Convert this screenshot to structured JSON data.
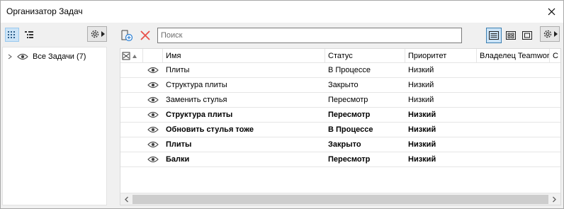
{
  "window": {
    "title": "Организатор Задач"
  },
  "left_panel": {
    "tree": [
      {
        "label": "Все Задачи (7)"
      }
    ]
  },
  "toolbar": {
    "search_placeholder": "Поиск"
  },
  "table": {
    "columns": [
      "Имя",
      "Статус",
      "Приоритет",
      "Владелец Teamwork",
      "С"
    ],
    "rows": [
      {
        "name": "Плиты",
        "status": "В Процессе",
        "priority": "Низкий",
        "bold": false
      },
      {
        "name": "Структура плиты",
        "status": "Закрыто",
        "priority": "Низкий",
        "bold": false
      },
      {
        "name": "Заменить стулья",
        "status": "Пересмотр",
        "priority": "Низкий",
        "bold": false
      },
      {
        "name": "Структура плиты",
        "status": "Пересмотр",
        "priority": "Низкий",
        "bold": true
      },
      {
        "name": "Обновить стулья тоже",
        "status": "В Процессе",
        "priority": "Низкий",
        "bold": true
      },
      {
        "name": "Плиты",
        "status": "Закрыто",
        "priority": "Низкий",
        "bold": true
      },
      {
        "name": "Балки",
        "status": "Пересмотр",
        "priority": "Низкий",
        "bold": true
      }
    ]
  },
  "colors": {
    "delete_icon": "#e8504a",
    "selection": "#cce4f7",
    "add_icon": "#2a7fd4"
  }
}
